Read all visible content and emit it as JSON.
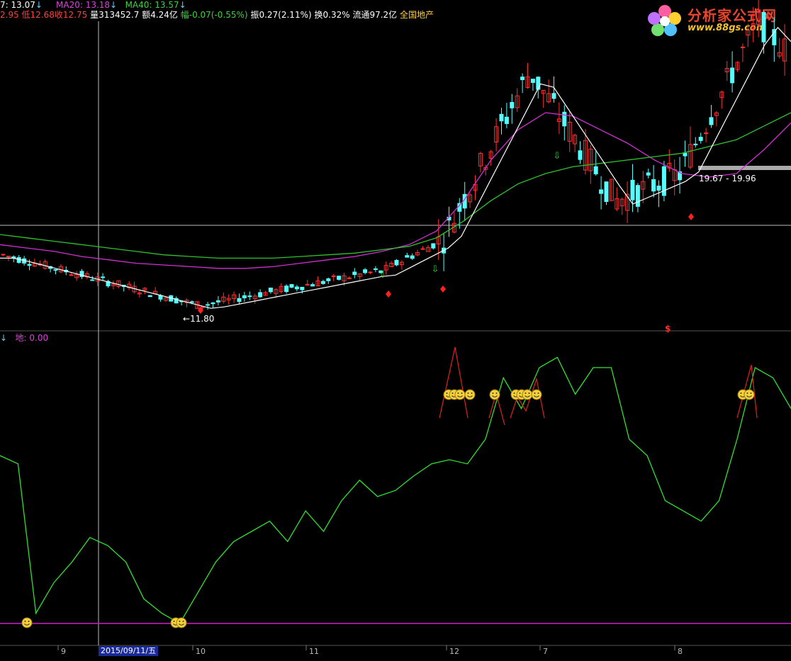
{
  "header": {
    "price_label": "7: 13.07",
    "ma20": "MA20: 13.18",
    "ma40": "MA40: 13.57",
    "line2_low_open": "2.95",
    "low": "低12.68",
    "close": "收12.75",
    "volume": "量313452.7",
    "amount": "额4.24亿",
    "change": "幅-0.07(-0.55%)",
    "amplitude": "振0.27(2.11%)",
    "turnover": "换0.32%",
    "float": "流通97.2亿",
    "sector": "全国地产"
  },
  "logo": {
    "title": "分析家公式网",
    "url": "www.88gs.com"
  },
  "lower_panel": {
    "indicator_label": "地: 0.00"
  },
  "annotations": {
    "low_price": "11.80",
    "range_label": "19.67 - 19.96",
    "dollar_mark": "$"
  },
  "cursor": {
    "date": "2015/09/11/五"
  },
  "colors": {
    "up_candle": "#ff3030",
    "down_candle": "#54ffff",
    "ma_white": "#ffffff",
    "ma20": "#d030d0",
    "ma40": "#30c030",
    "indicator": "#30e030",
    "peak": "#e02020",
    "baseline": "#cc20cc"
  },
  "chart_data": [
    {
      "type": "candlestick",
      "title": "",
      "series": [
        {
          "name": "MA20",
          "values": [
            13.9,
            13.8,
            13.7,
            13.55,
            13.45,
            13.35,
            13.3,
            13.25,
            13.2,
            13.2,
            13.25,
            13.35,
            13.45,
            13.55,
            13.7,
            13.9,
            14.3,
            15.2,
            16.4,
            17.3,
            17.8,
            17.7,
            17.3,
            16.9,
            16.4,
            16.0,
            15.9,
            16.0,
            16.7,
            17.5
          ]
        },
        {
          "name": "MA40",
          "values": [
            14.2,
            14.1,
            14.0,
            13.9,
            13.8,
            13.7,
            13.6,
            13.55,
            13.5,
            13.5,
            13.5,
            13.55,
            13.6,
            13.65,
            13.75,
            13.85,
            14.1,
            14.6,
            15.2,
            15.7,
            16.0,
            16.2,
            16.3,
            16.4,
            16.5,
            16.6,
            16.8,
            17.0,
            17.4,
            17.8
          ]
        }
      ],
      "x": [
        "8",
        "9",
        "10",
        "11",
        "12",
        "7",
        "8"
      ],
      "price_range": [
        11.5,
        20.5
      ]
    },
    {
      "type": "line",
      "title": "",
      "series": [
        {
          "name": "地",
          "values": [
            0.82,
            0.78,
            0.05,
            0.2,
            0.3,
            0.42,
            0.38,
            0.3,
            0.12,
            0.05,
            0.0,
            0.15,
            0.3,
            0.4,
            0.45,
            0.5,
            0.4,
            0.55,
            0.45,
            0.6,
            0.7,
            0.62,
            0.65,
            0.72,
            0.78,
            0.8,
            0.78,
            0.9,
            1.2,
            1.05,
            1.25,
            1.3,
            1.12,
            1.25,
            1.25,
            0.9,
            0.82,
            0.6,
            0.55,
            0.5,
            0.6,
            0.9,
            1.25,
            1.2,
            1.05
          ]
        }
      ],
      "baseline": 0
    }
  ]
}
